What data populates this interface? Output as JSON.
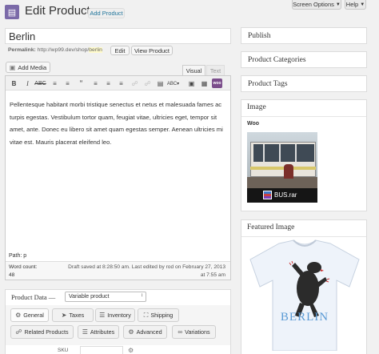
{
  "header": {
    "title": "Edit Product",
    "add_new": "Add Product",
    "screen_options": "Screen Options",
    "help": "Help"
  },
  "post": {
    "title": "Berlin",
    "permalink_label": "Permalink:",
    "permalink_base": "http://wp99.dev/shop/",
    "permalink_slug": "berlin",
    "edit": "Edit",
    "view": "View Product"
  },
  "editor": {
    "add_media": "Add Media",
    "tab_visual": "Visual",
    "tab_text": "Text",
    "content": "Pellentesque habitant morbi tristique senectus et netus et malesuada fames ac turpis egestas. Vestibulum tortor quam, feugiat vitae, ultricies eget, tempor sit amet, ante. Donec eu libero sit amet quam egestas semper. Aenean ultricies mi vitae est. Mauris placerat eleifend leo.",
    "path": "Path: p",
    "word_count_label": "Word count:",
    "word_count": "48",
    "draft_saved": "Draft saved at 8:28:50 am. Last edited by rod on February 27, 2013",
    "draft_time": "at 7:55 am"
  },
  "product_data": {
    "label": "Product Data —",
    "type_selected": "Variable product",
    "tabs": [
      "General",
      "Taxes",
      "Inventory",
      "Shipping",
      "Related Products",
      "Attributes",
      "Advanced",
      "Variations"
    ],
    "sku_label": "SKU"
  },
  "sidebar": {
    "publish": "Publish",
    "categories": "Product Categories",
    "tags": "Product Tags",
    "image": "Image",
    "image_caption": "Woo",
    "image_file": "BUS.rar",
    "featured": "Featured Image",
    "tshirt_text": "BERLIN"
  }
}
